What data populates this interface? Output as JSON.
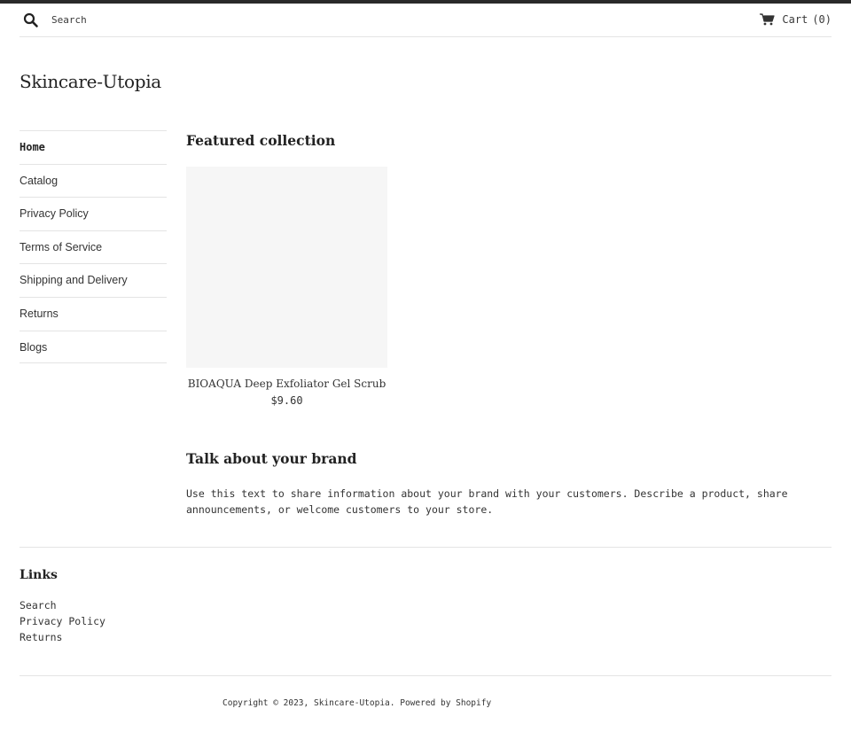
{
  "header": {
    "search_placeholder": "Search",
    "cart_label": "Cart",
    "cart_count": "(0)"
  },
  "brand": {
    "logo": "Skincare-Utopia"
  },
  "sidebar": {
    "items": [
      {
        "label": "Home",
        "active": true
      },
      {
        "label": "Catalog"
      },
      {
        "label": "Privacy Policy"
      },
      {
        "label": "Terms of Service"
      },
      {
        "label": "Shipping and Delivery"
      },
      {
        "label": "Returns"
      },
      {
        "label": "Blogs"
      }
    ]
  },
  "featured": {
    "title": "Featured collection",
    "products": [
      {
        "name": "BIOAQUA Deep Exfoliator Gel Scrub",
        "price": "$9.60"
      }
    ]
  },
  "about": {
    "title": "Talk about your brand",
    "text": "Use this text to share information about your brand with your customers. Describe a product, share announcements, or welcome customers to your store."
  },
  "footer": {
    "links_title": "Links",
    "links": [
      "Search",
      "Privacy Policy",
      "Returns"
    ],
    "copyright_prefix": "Copyright © 2023,",
    "copyright_store": "Skincare-Utopia",
    "powered_by": "Powered by Shopify"
  },
  "icons": {
    "search": "search-icon",
    "cart": "cart-icon"
  },
  "colors": {
    "text": "#2a2a2a",
    "border": "#e4e4e4",
    "product_placeholder": "#f6f6f6"
  }
}
